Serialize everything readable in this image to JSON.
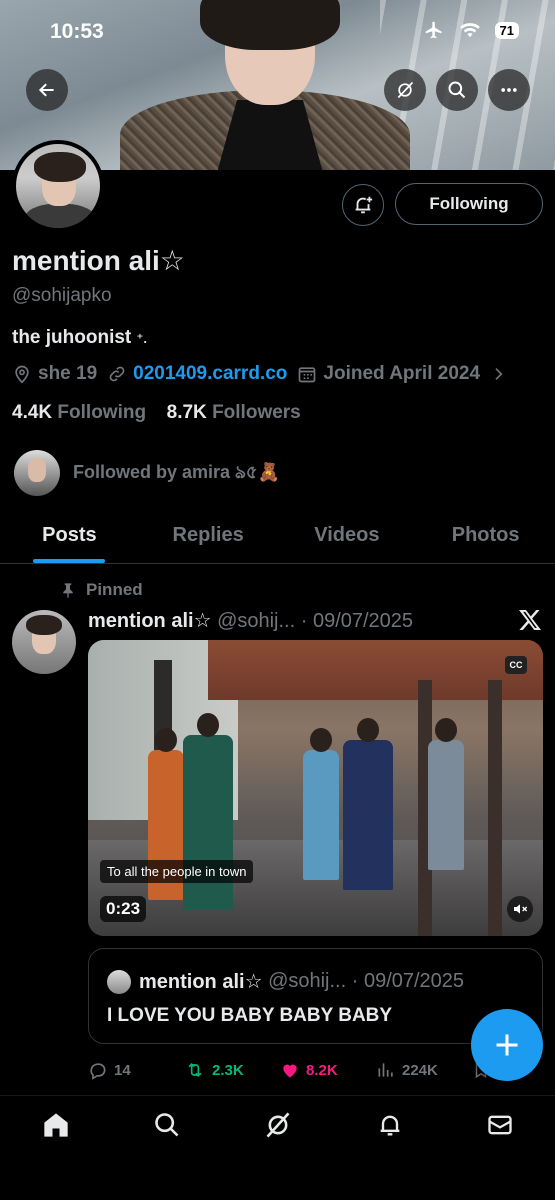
{
  "status_bar": {
    "time": "10:53",
    "battery": "71"
  },
  "profile": {
    "display_name": "mention ali☆",
    "handle": "@sohijapko",
    "bio": "the juhoonist",
    "location": "she 19",
    "website": "0201409.carrd.co",
    "joined": "Joined April 2024",
    "following_count": "4.4K",
    "following_label": "Following",
    "followers_count": "8.7K",
    "followers_label": "Followers",
    "followed_by": "Followed by amira ঌ৫🧸",
    "follow_button": "Following"
  },
  "tabs": [
    "Posts",
    "Replies",
    "Videos",
    "Photos"
  ],
  "post": {
    "pinned_label": "Pinned",
    "author": "mention ali☆",
    "handle_date": "@sohij... · 09/07/2025",
    "video": {
      "caption": "To all the people in town",
      "duration": "0:23",
      "cc": "CC"
    },
    "quote": {
      "author": "mention ali☆",
      "handle_date": "@sohij... · 09/07/2025",
      "text": "I LOVE YOU BABY BABY BABY"
    },
    "stats": {
      "replies": "14",
      "reposts": "2.3K",
      "likes": "8.2K",
      "views": "224K"
    }
  },
  "colors": {
    "accent": "#1d9bf0",
    "repost": "#00ba7c",
    "like": "#f91880",
    "muted": "#71767b"
  }
}
